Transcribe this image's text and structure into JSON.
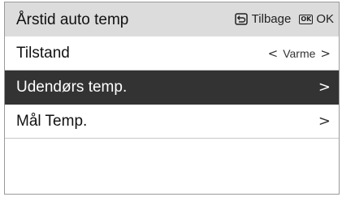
{
  "header": {
    "title": "Årstid auto temp",
    "back_label": "Tilbage",
    "ok_label": "OK",
    "ok_icon_text": "OK"
  },
  "rows": [
    {
      "label": "Tilstand",
      "value": "Varme",
      "left_arrow": "<",
      "right_arrow": ">"
    },
    {
      "label": "Udendørs temp.",
      "chevron": ">"
    },
    {
      "label": "Mål Temp.",
      "chevron": ">"
    }
  ],
  "colors": {
    "header_bg": "#dcdcdc",
    "selected_bg": "#333333",
    "border": "#9a9a9a"
  }
}
